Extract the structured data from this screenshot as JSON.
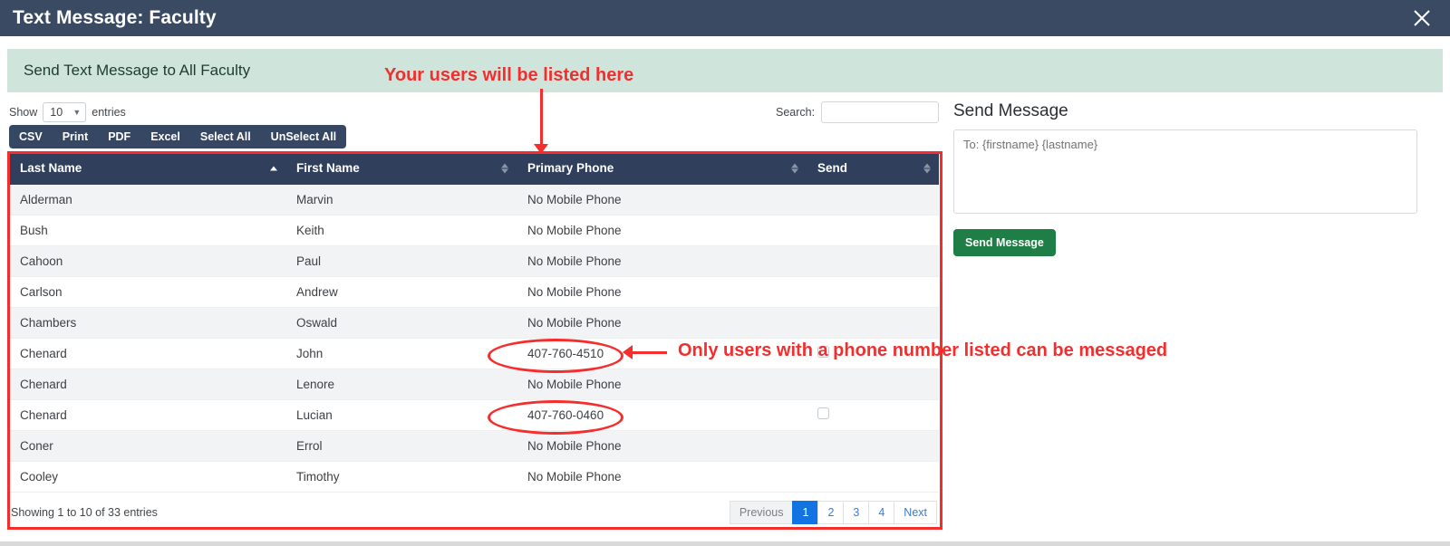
{
  "titlebar": {
    "title": "Text Message: Faculty",
    "close_icon": "close-icon"
  },
  "banner": {
    "text": "Send Text Message to All Faculty"
  },
  "controls": {
    "show_label": "Show",
    "entries_label": "entries",
    "page_length": "10",
    "chevron_icon": "chevron-down-icon",
    "search_label": "Search:",
    "search_value": "",
    "search_placeholder": ""
  },
  "export_buttons": [
    {
      "label": "CSV"
    },
    {
      "label": "Print"
    },
    {
      "label": "PDF"
    },
    {
      "label": "Excel"
    },
    {
      "label": "Select All"
    },
    {
      "label": "UnSelect All"
    }
  ],
  "table": {
    "columns": [
      {
        "label": "Last Name",
        "sort": "asc"
      },
      {
        "label": "First Name",
        "sort": "none"
      },
      {
        "label": "Primary Phone",
        "sort": "none"
      },
      {
        "label": "Send",
        "sort": "none"
      }
    ],
    "rows": [
      {
        "last": "Alderman",
        "first": "Marvin",
        "phone": "No Mobile Phone",
        "has_phone": false,
        "checkbox": false
      },
      {
        "last": "Bush",
        "first": "Keith",
        "phone": "No Mobile Phone",
        "has_phone": false,
        "checkbox": false
      },
      {
        "last": "Cahoon",
        "first": "Paul",
        "phone": "No Mobile Phone",
        "has_phone": false,
        "checkbox": false
      },
      {
        "last": "Carlson",
        "first": "Andrew",
        "phone": "No Mobile Phone",
        "has_phone": false,
        "checkbox": false
      },
      {
        "last": "Chambers",
        "first": "Oswald",
        "phone": "No Mobile Phone",
        "has_phone": false,
        "checkbox": false
      },
      {
        "last": "Chenard",
        "first": "John",
        "phone": "407-760-4510",
        "has_phone": true,
        "checkbox": true
      },
      {
        "last": "Chenard",
        "first": "Lenore",
        "phone": "No Mobile Phone",
        "has_phone": false,
        "checkbox": false
      },
      {
        "last": "Chenard",
        "first": "Lucian",
        "phone": "407-760-0460",
        "has_phone": true,
        "checkbox": true
      },
      {
        "last": "Coner",
        "first": "Errol",
        "phone": "No Mobile Phone",
        "has_phone": false,
        "checkbox": false
      },
      {
        "last": "Cooley",
        "first": "Timothy",
        "phone": "No Mobile Phone",
        "has_phone": false,
        "checkbox": false
      }
    ]
  },
  "footer": {
    "info": "Showing 1 to 10 of 33 entries",
    "pagination": [
      {
        "label": "Previous",
        "state": "disabled"
      },
      {
        "label": "1",
        "state": "active"
      },
      {
        "label": "2",
        "state": "normal"
      },
      {
        "label": "3",
        "state": "normal"
      },
      {
        "label": "4",
        "state": "normal"
      },
      {
        "label": "Next",
        "state": "normal"
      }
    ]
  },
  "send_panel": {
    "title": "Send Message",
    "message_value": "",
    "message_placeholder": "To: {firstname} {lastname}",
    "button_label": "Send Message"
  },
  "annotations": {
    "top_note": "Your users will be listed here",
    "right_note": "Only users with a phone number listed can be messaged"
  },
  "colors": {
    "titlebar_bg": "#3b4a63",
    "banner_bg": "#cfe5dc",
    "table_header_bg": "#2f3f5c",
    "export_bar_bg": "#364763",
    "no_phone_text": "#e8636f",
    "send_button_bg": "#1e7e45",
    "pagination_active_bg": "#1274e3",
    "annotation_red": "#f42d2d"
  }
}
